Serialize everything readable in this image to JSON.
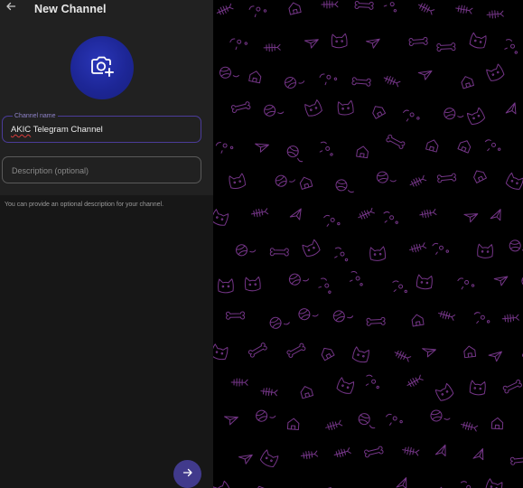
{
  "header": {
    "back_icon": "arrow-left-icon",
    "title": "New Channel"
  },
  "avatar_picker": {
    "icon": "camera-add-icon",
    "color": "#1d2696"
  },
  "channel_name": {
    "label": "Channel name",
    "value_prefix": "AKIC",
    "value_rest": " Telegram Channel"
  },
  "description": {
    "placeholder": "Description (optional)"
  },
  "hint": "You can provide an optional description for your channel.",
  "next_button": {
    "icon": "arrow-right-icon",
    "color": "#413a8c"
  },
  "chat_background": {
    "pattern": "cats-doodle-pattern",
    "line_color": "#8a3fa0",
    "background_color": "#000000"
  }
}
